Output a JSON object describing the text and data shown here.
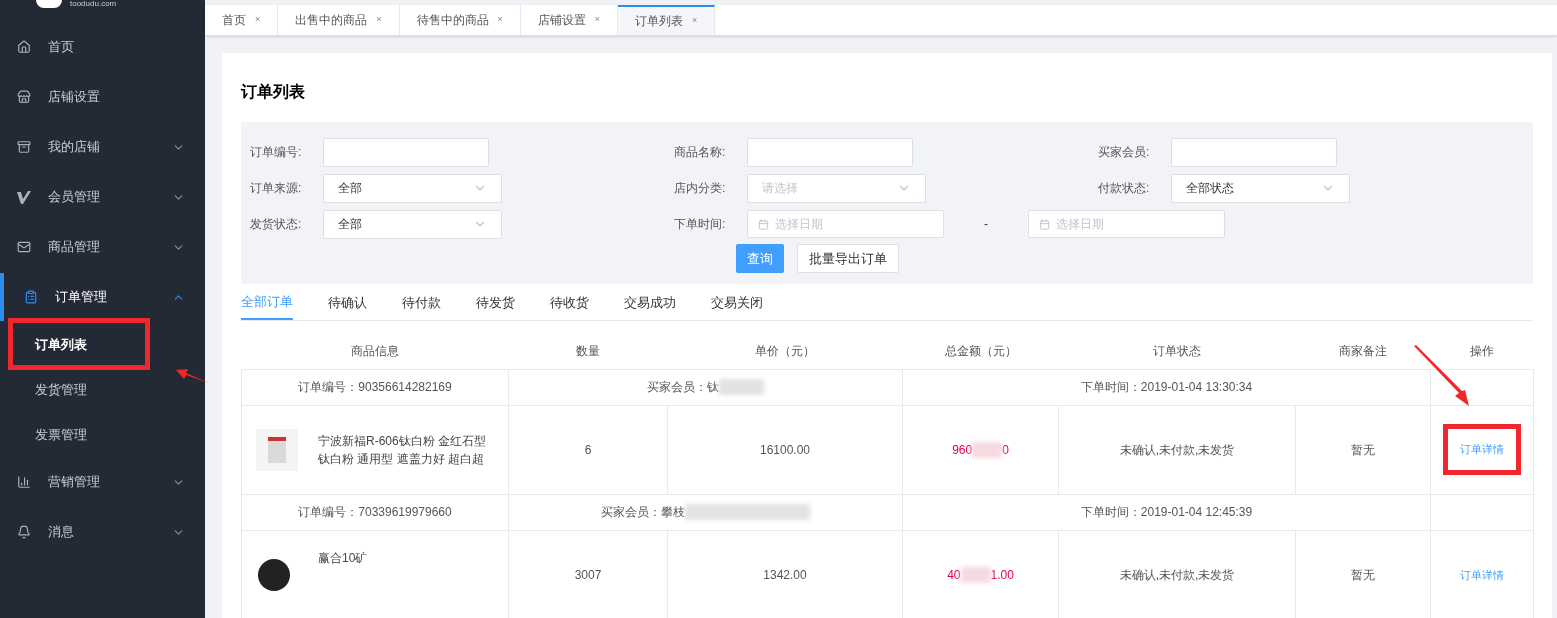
{
  "logo": {
    "text": "toodudu.com"
  },
  "sidebar": {
    "items": [
      {
        "label": "首页",
        "kind": "link",
        "selected": false
      },
      {
        "label": "店铺设置",
        "kind": "link",
        "selected": false
      },
      {
        "label": "我的店铺",
        "kind": "group",
        "expanded": false,
        "selected": false
      },
      {
        "label": "会员管理",
        "kind": "group",
        "expanded": false,
        "selected": false
      },
      {
        "label": "商品管理",
        "kind": "group",
        "expanded": false,
        "selected": false
      },
      {
        "label": "订单管理",
        "kind": "group",
        "expanded": true,
        "selected": true,
        "children": [
          {
            "label": "订单列表",
            "selected": true
          },
          {
            "label": "发货管理",
            "selected": false
          },
          {
            "label": "发票管理",
            "selected": false
          }
        ]
      },
      {
        "label": "营销管理",
        "kind": "group",
        "expanded": false,
        "selected": false
      },
      {
        "label": "消息",
        "kind": "group",
        "expanded": false,
        "selected": false
      }
    ]
  },
  "tabs": [
    {
      "label": "首页",
      "close": "×",
      "selected": false
    },
    {
      "label": "出售中的商品",
      "close": "×",
      "selected": false
    },
    {
      "label": "待售中的商品",
      "close": "×",
      "selected": false
    },
    {
      "label": "店铺设置",
      "close": "×",
      "selected": false
    },
    {
      "label": "订单列表",
      "close": "×",
      "selected": true
    }
  ],
  "page_title": "订单列表",
  "filters": [
    [
      {
        "label": "订单编号:",
        "kind": "input"
      },
      {
        "label": "商品名称:",
        "kind": "input"
      },
      {
        "label": "买家会员:",
        "kind": "input"
      }
    ],
    [
      {
        "label": "订单来源:",
        "kind": "select",
        "value": "全部"
      },
      {
        "label": "店内分类:",
        "kind": "select",
        "placeholder": "请选择"
      },
      {
        "label": "付款状态:",
        "kind": "select",
        "value": "全部状态"
      }
    ],
    [
      {
        "label": "发货状态:",
        "kind": "select",
        "value": "全部"
      },
      {
        "label": "下单时间:",
        "kind": "daterange",
        "placeholder": "选择日期",
        "separator": "-",
        "placeholder_end": "选择日期"
      }
    ]
  ],
  "buttons": [
    {
      "label": "查询",
      "kind": "primary"
    },
    {
      "label": "批量导出订单",
      "kind": "default"
    }
  ],
  "status_tabs": [
    {
      "label": "全部订单",
      "selected": true
    },
    {
      "label": "待确认",
      "selected": false
    },
    {
      "label": "待付款",
      "selected": false
    },
    {
      "label": "待发货",
      "selected": false
    },
    {
      "label": "待收货",
      "selected": false
    },
    {
      "label": "交易成功",
      "selected": false
    },
    {
      "label": "交易关闭",
      "selected": false
    }
  ],
  "table": {
    "columns": [
      "商品信息",
      "数量",
      "单价（元）",
      "总金额（元）",
      "订单状态",
      "商家备注",
      "操作"
    ],
    "orders": [
      {
        "order_no": "订单编号：90356614282169",
        "buyer": "买家会员：钛",
        "time": "下单时间：2019-01-04 13:30:34",
        "product": "宁波新福R-606钛白粉 金红石型钛白粉 通用型 遮盖力好 超白超",
        "quantity": "6",
        "price": "16100.00",
        "total_start": "960",
        "total_end": "0",
        "status": "未确认,未付款,未发货",
        "note": "暂无",
        "action": "订单详情",
        "highlighted": true
      },
      {
        "order_no": "订单编号：70339619979660",
        "buyer": "买家会员：攀枝",
        "time": "下单时间：2019-01-04 12:45:39",
        "product": "赢合10矿",
        "quantity": "3007",
        "price": "1342.00",
        "total_start": "40",
        "total_end": "1.00",
        "status": "未确认,未付款,未发货",
        "note": "暂无",
        "action": "订单详情",
        "highlighted": false
      }
    ]
  }
}
